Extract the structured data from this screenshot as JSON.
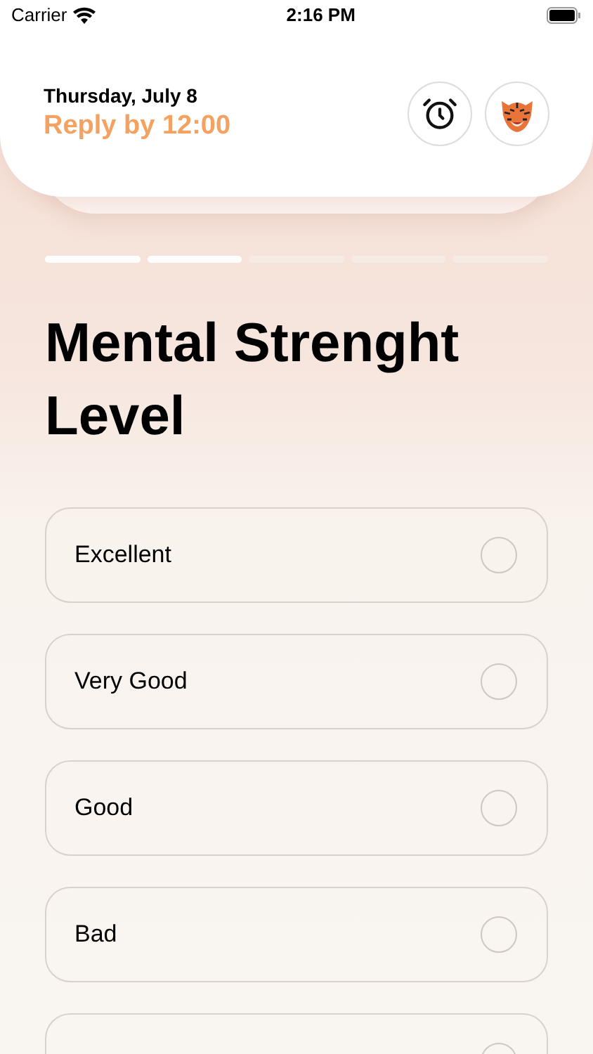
{
  "status_bar": {
    "carrier": "Carrier",
    "time": "2:16 PM"
  },
  "header": {
    "date": "Thursday, July 8",
    "deadline": "Reply by 12:00"
  },
  "progress_steps": [
    {
      "done": true
    },
    {
      "done": true
    },
    {
      "done": false
    },
    {
      "done": false
    },
    {
      "done": false
    }
  ],
  "question": {
    "title": "Mental Strenght Level"
  },
  "options": [
    {
      "label": "Excellent",
      "selected": false
    },
    {
      "label": "Very Good",
      "selected": false
    },
    {
      "label": "Good",
      "selected": false
    },
    {
      "label": "Bad",
      "selected": false
    },
    {
      "selected": false
    }
  ]
}
